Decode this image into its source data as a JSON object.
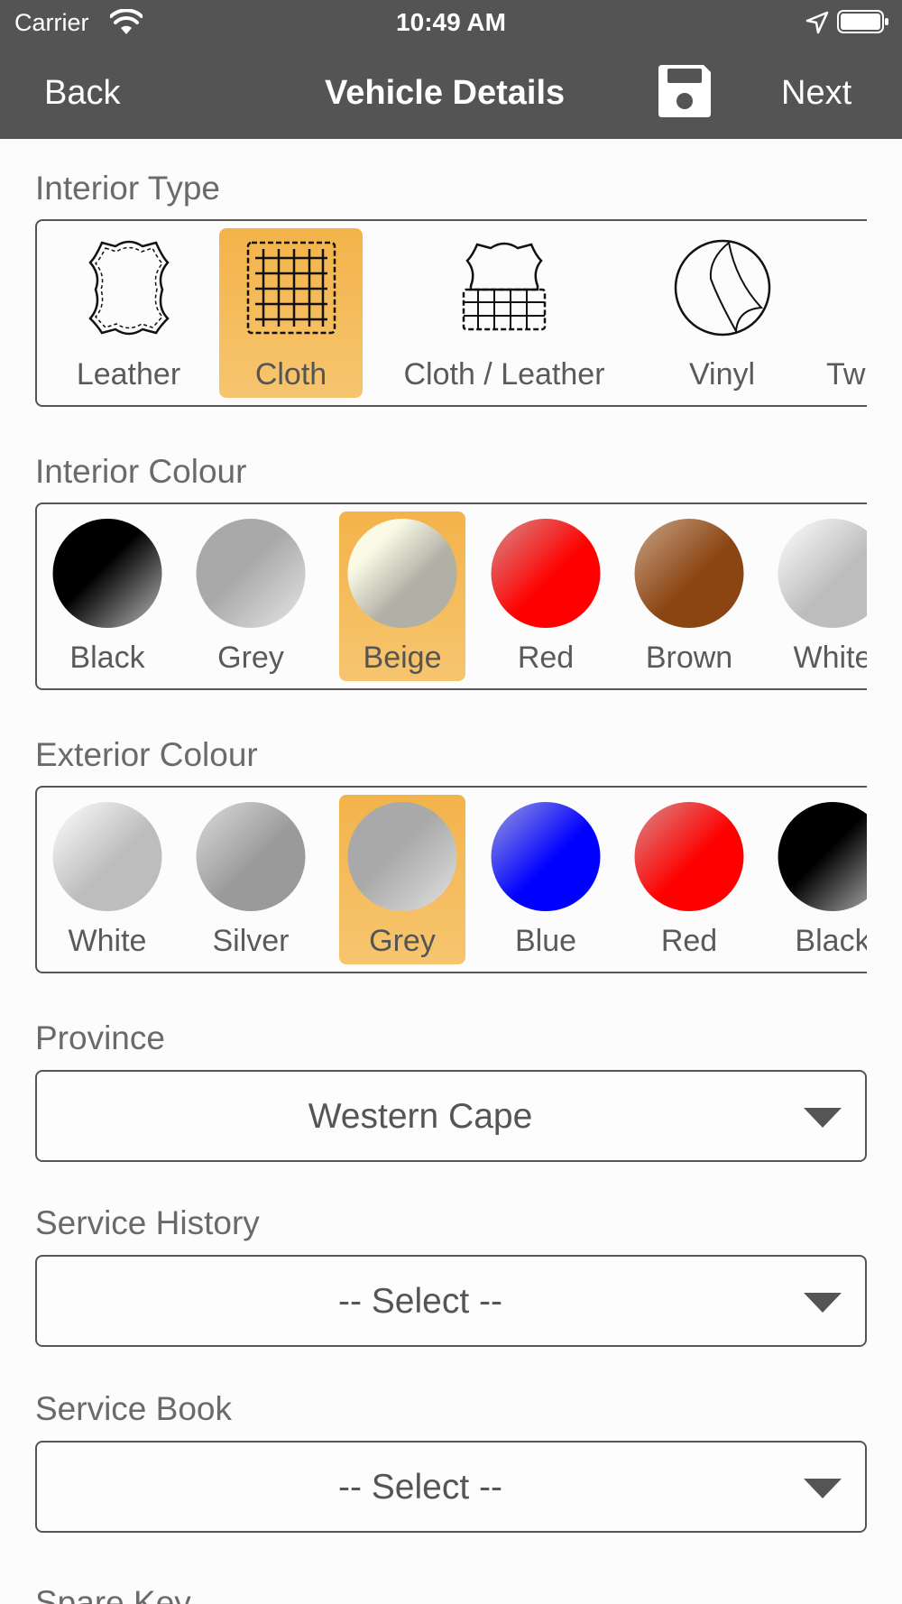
{
  "status_bar": {
    "carrier": "Carrier",
    "time": "10:49 AM"
  },
  "nav": {
    "back": "Back",
    "title": "Vehicle Details",
    "next": "Next",
    "save_icon": "floppy-disk-icon"
  },
  "interior_type": {
    "label": "Interior Type",
    "options": [
      {
        "label": "Leather",
        "icon": "leather-hide-icon",
        "selected": false
      },
      {
        "label": "Cloth",
        "icon": "cloth-grid-icon",
        "selected": true
      },
      {
        "label": "Cloth / Leather",
        "icon": "cloth-leather-icon",
        "selected": false
      },
      {
        "label": "Vinyl",
        "icon": "vinyl-icon",
        "selected": false
      },
      {
        "label": "Tw",
        "icon": "",
        "selected": false
      }
    ]
  },
  "interior_colour": {
    "label": "Interior Colour",
    "options": [
      {
        "label": "Black",
        "color": "#000000",
        "selected": false
      },
      {
        "label": "Grey",
        "color": "#a9a9a9",
        "selected": false
      },
      {
        "label": "Beige",
        "color": "#f5f5dc",
        "selected": true
      },
      {
        "label": "Red",
        "color": "#ff0000",
        "selected": false
      },
      {
        "label": "Brown",
        "color": "#8b4513",
        "selected": false
      },
      {
        "label": "White",
        "color": "#ffffff",
        "selected": false
      }
    ]
  },
  "exterior_colour": {
    "label": "Exterior Colour",
    "options": [
      {
        "label": "White",
        "color": "#ffffff",
        "selected": false
      },
      {
        "label": "Silver",
        "color": "#a0a0a0",
        "selected": false
      },
      {
        "label": "Grey",
        "color": "#a9a9a9",
        "selected": true
      },
      {
        "label": "Blue",
        "color": "#0000ff",
        "selected": false
      },
      {
        "label": "Red",
        "color": "#ff0000",
        "selected": false
      },
      {
        "label": "Black",
        "color": "#000000",
        "selected": false
      }
    ]
  },
  "province": {
    "label": "Province",
    "value": "Western Cape"
  },
  "service_history": {
    "label": "Service History",
    "value": "-- Select --"
  },
  "service_book": {
    "label": "Service Book",
    "value": "-- Select --"
  },
  "next_section": {
    "label": "Spare Key"
  },
  "colors": {
    "nav_bg": "#545454",
    "selected_bg": "#f4b34a",
    "text": "#555555"
  }
}
